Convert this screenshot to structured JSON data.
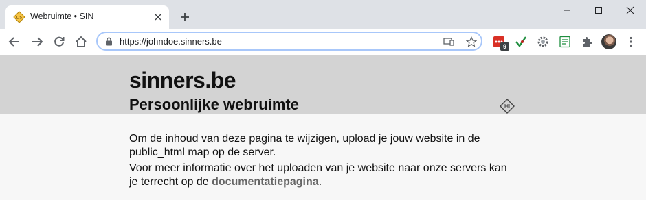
{
  "browser": {
    "tab": {
      "title": "Webruimte • SIN"
    },
    "address_bar": {
      "url": "https://johndoe.sinners.be"
    },
    "extensions": {
      "badge_count": "9"
    }
  },
  "page": {
    "site_title": "sinners.be",
    "subtitle": "Persoonlijke webruimte",
    "paragraph1": "Om de inhoud van deze pagina te wijzigen, upload je jouw website in de public_html map op de server.",
    "paragraph2_prefix": "Voor meer informatie over het uploaden van je website naar onze servers kan je terrecht op de ",
    "paragraph2_link": "documentatiepagina",
    "paragraph2_suffix": "."
  },
  "colors": {
    "tabstrip": "#dee1e6",
    "header_band": "#d3d3d3",
    "page_bg": "#f7f7f7",
    "link": "#666666"
  }
}
